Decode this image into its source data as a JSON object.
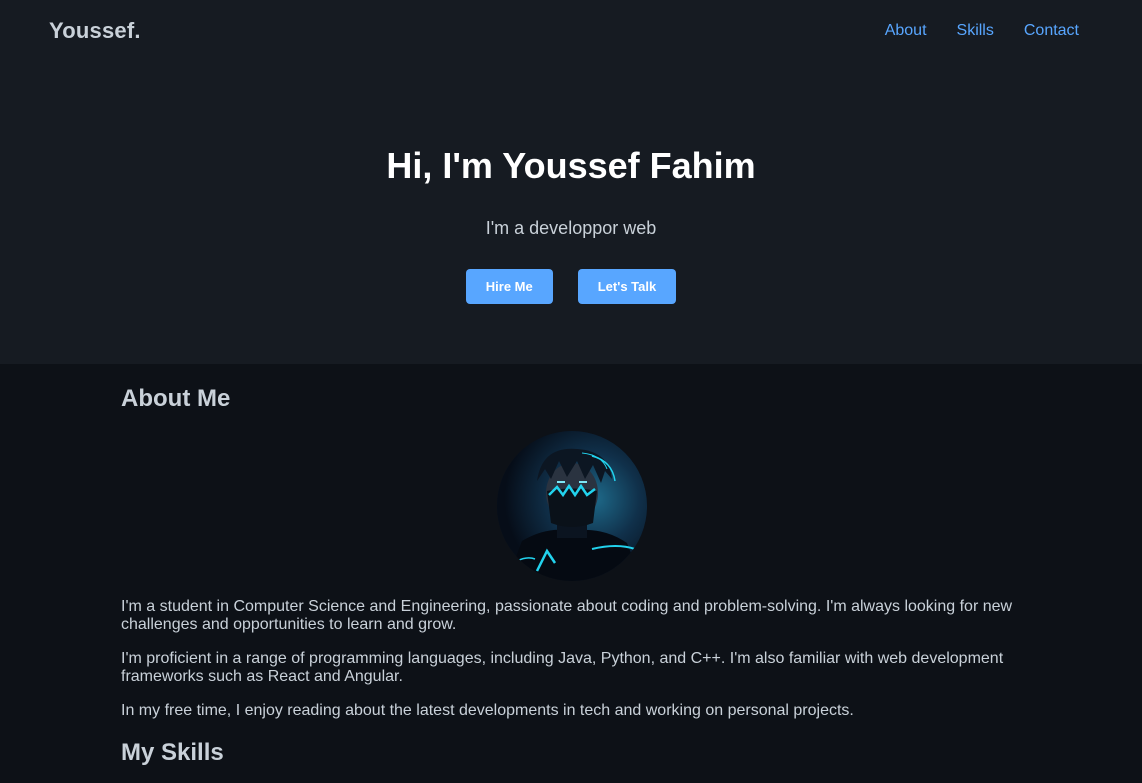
{
  "header": {
    "logo": "Youssef.",
    "nav": [
      "About",
      "Skills",
      "Contact"
    ]
  },
  "hero": {
    "title": "Hi, I'm Youssef Fahim",
    "subtitle": "I'm a developpor web",
    "buttons": [
      "Hire Me",
      "Let's Talk"
    ]
  },
  "about": {
    "title": "About Me",
    "paragraphs": [
      "I'm a student in Computer Science and Engineering, passionate about coding and problem-solving. I'm always looking for new challenges and opportunities to learn and grow.",
      "I'm proficient in a range of programming languages, including Java, Python, and C++. I'm also familiar with web development frameworks such as React and Angular.",
      "In my free time, I enjoy reading about the latest developments in tech and working on personal projects."
    ]
  },
  "skills": {
    "title": "My Skills"
  },
  "colors": {
    "accent": "#58a6ff",
    "hero_bg": "#161b22",
    "page_bg": "#0d1117",
    "text": "#c9d1d9",
    "avatar_glow": "#22d3ee"
  }
}
